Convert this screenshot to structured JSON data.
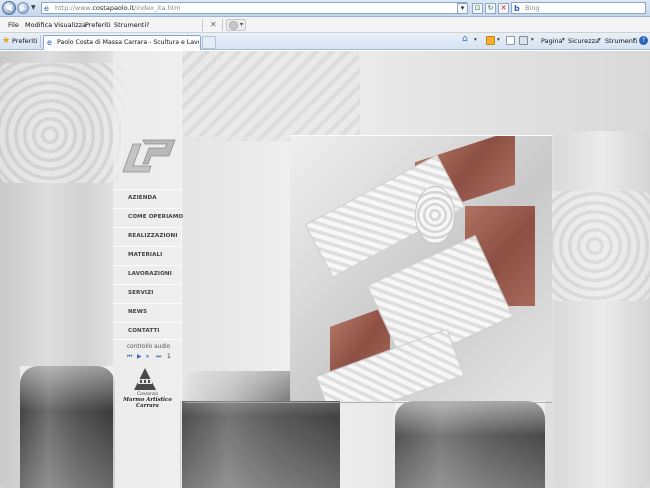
{
  "browser": {
    "url_prefix": "http://www.",
    "url_domain": "costapaolo.it",
    "url_suffix": "/index_ita.htm",
    "search_placeholder": "Bing",
    "menu": [
      "File",
      "Modifica",
      "Visualizza",
      "Preferiti",
      "Strumenti",
      "?"
    ],
    "favorites_label": "Preferiti",
    "tab_title": "Paolo Costa di Massa Carrara - Scultura e Lavorazion...",
    "commands": {
      "page": "Pagina",
      "safety": "Sicurezza",
      "tools": "Strumenti"
    }
  },
  "site": {
    "nav": [
      "AZIENDA",
      "COME OPERIAMO",
      "REALIZZAZIONI",
      "MATERIALI",
      "LAVORAZIONI",
      "SERVIZI",
      "NEWS",
      "CONTATTI"
    ],
    "audio_label": "controllo audio",
    "audio_track": "1",
    "consorzio_small": "Consorzio",
    "consorzio_line1": "Marmo Artistico",
    "consorzio_line2": "Carrara"
  }
}
